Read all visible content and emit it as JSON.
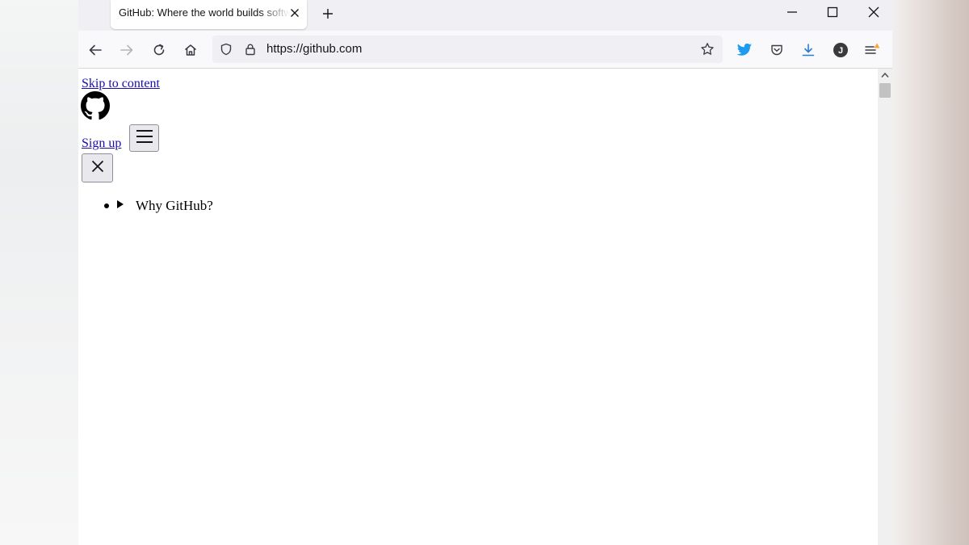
{
  "tab": {
    "title": "GitHub: Where the world builds software"
  },
  "navbar": {
    "url": "https://github.com"
  },
  "page": {
    "skip_link": "Skip to content",
    "signup_link": "Sign up",
    "menu_items": [
      {
        "label": "Why GitHub?"
      }
    ]
  },
  "colors": {
    "link": "#1a0dab",
    "twitter": "#1d9bf0",
    "notification_dot": "#ffa436",
    "account_avatar": "#3a3a3a"
  },
  "icons": {
    "navigation": [
      "back-arrow-icon",
      "forward-arrow-icon",
      "reload-icon",
      "home-icon"
    ],
    "url": [
      "tracking-shield-icon",
      "padlock-icon",
      "bookmark-star-icon"
    ],
    "toolbar": [
      "twitter-bird-icon",
      "pocket-icon",
      "download-icon",
      "account-avatar-icon",
      "app-menu-icon"
    ],
    "window": [
      "minimize-icon",
      "maximize-icon",
      "close-window-icon"
    ],
    "page": [
      "github-octocat-icon",
      "hamburger-menu-icon",
      "close-icon"
    ]
  },
  "account_initial": "J"
}
